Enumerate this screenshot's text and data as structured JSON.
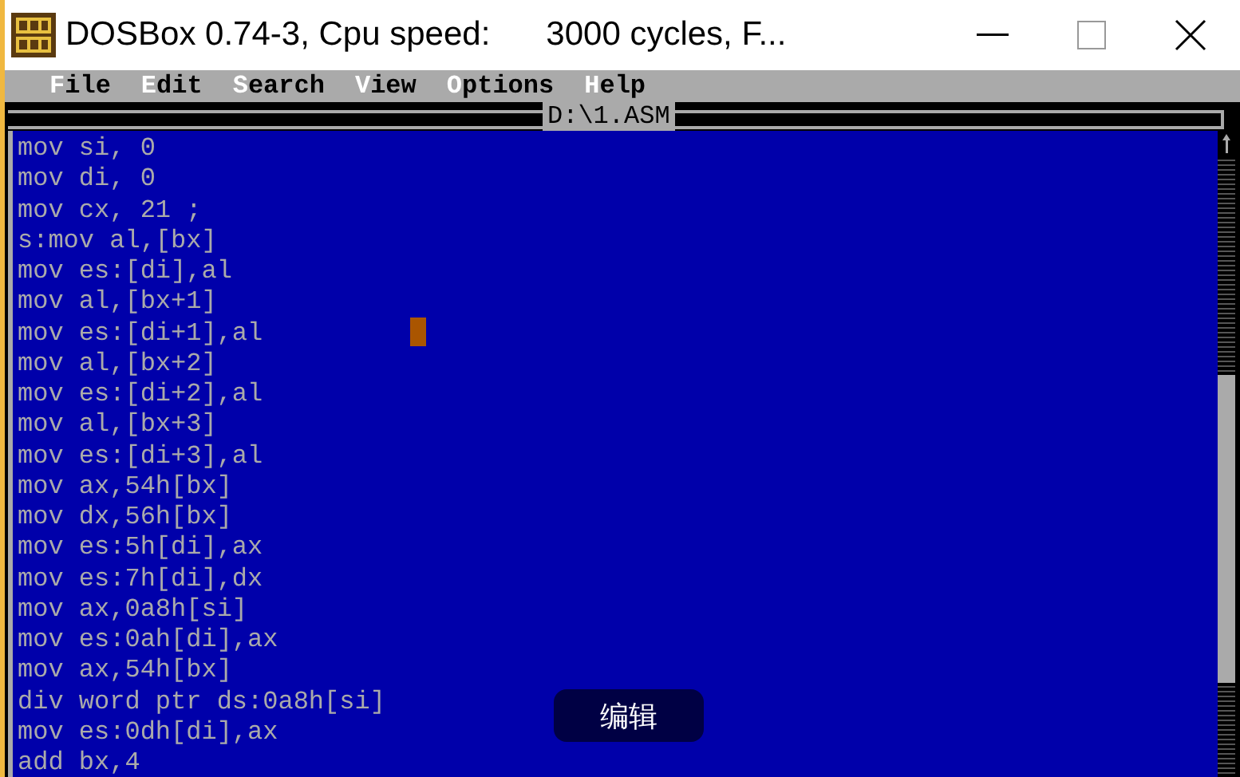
{
  "window": {
    "title": "DOSBox 0.74-3, Cpu speed:      3000 cycles, F..."
  },
  "menu": [
    "File",
    "Edit",
    "Search",
    "View",
    "Options",
    "Help"
  ],
  "editor": {
    "file_name": "D:\\1.ASM",
    "lines": [
      "mov si, 0",
      "mov di, 0",
      "mov cx, 21 ;",
      "s:mov al,[bx]",
      "mov es:[di],al",
      "mov al,[bx+1]",
      "mov es:[di+1],al",
      "mov al,[bx+2]",
      "mov es:[di+2],al",
      "mov al,[bx+3]",
      "mov es:[di+3],al",
      "mov ax,54h[bx]",
      "mov dx,56h[bx]",
      "mov es:5h[di],ax",
      "mov es:7h[di],dx",
      "mov ax,0a8h[si]",
      "mov es:0ah[di],ax",
      "mov ax,54h[bx]",
      "div word ptr ds:0a8h[si]",
      "mov es:0dh[di],ax",
      "add bx,4"
    ]
  },
  "overlay_button": "编辑"
}
